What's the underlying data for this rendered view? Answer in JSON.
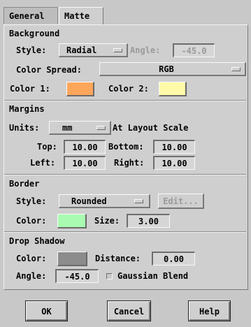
{
  "tabs": [
    {
      "label": "General",
      "active": false
    },
    {
      "label": "Matte",
      "active": true
    }
  ],
  "background": {
    "header": "Background",
    "style_label": "Style:",
    "style_value": "Radial",
    "angle_label": "Angle:",
    "angle_value": "-45.0",
    "spread_label": "Color Spread:",
    "spread_value": "RGB",
    "color1_label": "Color 1:",
    "color1": "#fba65b",
    "color2_label": "Color 2:",
    "color2": "#fffaa8"
  },
  "margins": {
    "header": "Margins",
    "units_label": "Units:",
    "units_value": "mm",
    "scale_text": "At Layout Scale",
    "top_label": "Top:",
    "top_value": "10.00",
    "bottom_label": "Bottom:",
    "bottom_value": "10.00",
    "left_label": "Left:",
    "left_value": "10.00",
    "right_label": "Right:",
    "right_value": "10.00"
  },
  "border": {
    "header": "Border",
    "style_label": "Style:",
    "style_value": "Rounded",
    "edit_label": "Edit...",
    "color_label": "Color:",
    "color": "#a8fbb0",
    "size_label": "Size:",
    "size_value": "3.00"
  },
  "shadow": {
    "header": "Drop Shadow",
    "color_label": "Color:",
    "color": "#8c8c8c",
    "distance_label": "Distance:",
    "distance_value": "0.00",
    "angle_label": "Angle:",
    "angle_value": "-45.0",
    "gaussian_label": "Gaussian Blend",
    "gaussian_checked": false
  },
  "buttons": {
    "ok": "OK",
    "cancel": "Cancel",
    "help": "Help"
  }
}
